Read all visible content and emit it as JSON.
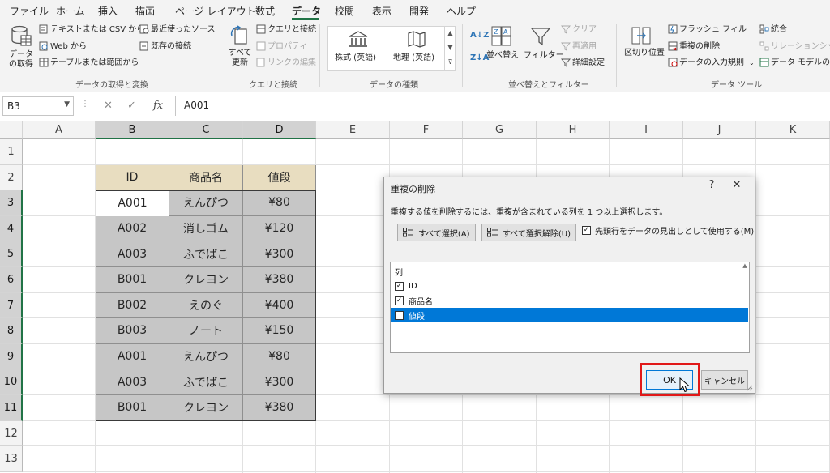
{
  "menu": {
    "tabs": [
      "ファイル",
      "ホーム",
      "挿入",
      "描画",
      "ページ レイアウト",
      "数式",
      "データ",
      "校閲",
      "表示",
      "開発",
      "ヘルプ"
    ],
    "active_tab": "データ",
    "accent_color": "#217346"
  },
  "ribbon": {
    "get_transform": {
      "label": "データの取得と変換",
      "get_data": "データの取得",
      "from_text_csv": "テキストまたは CSV から",
      "from_web": "Web から",
      "from_table": "テーブルまたは範囲から",
      "recent_sources": "最近使ったソース",
      "existing_connections": "既存の接続"
    },
    "queries": {
      "label": "クエリと接続",
      "refresh_all": "すべて更新",
      "queries_connections": "クエリと接続",
      "properties": "プロパティ",
      "edit_links": "リンクの編集"
    },
    "data_types": {
      "label": "データの種類",
      "stocks": "株式 (英語)",
      "geography": "地理 (英語)"
    },
    "sort_filter": {
      "label": "並べ替えとフィルター",
      "sort": "並べ替え",
      "filter": "フィルター",
      "clear": "クリア",
      "reapply": "再適用",
      "advanced": "詳細設定"
    },
    "data_tools": {
      "label": "データ ツール",
      "text_to_columns": "区切り位置",
      "flash_fill": "フラッシュ フィル",
      "remove_duplicates": "重複の削除",
      "data_validation": "データの入力規則",
      "consolidate": "統合",
      "relationships": "リレーションシップ",
      "data_model": "データ モデルの管"
    }
  },
  "formula_bar": {
    "name_box": "B3",
    "formula": "A001"
  },
  "sheet": {
    "columns": [
      "A",
      "B",
      "C",
      "D",
      "E",
      "F",
      "G",
      "H",
      "I",
      "J",
      "K"
    ],
    "rows": [
      "1",
      "2",
      "3",
      "4",
      "5",
      "6",
      "7",
      "8",
      "9",
      "10",
      "11",
      "12",
      "13"
    ],
    "table_headers": [
      "ID",
      "商品名",
      "値段"
    ],
    "table_rows": [
      [
        "A001",
        "えんぴつ",
        "¥80"
      ],
      [
        "A002",
        "消しゴム",
        "¥120"
      ],
      [
        "A003",
        "ふでばこ",
        "¥300"
      ],
      [
        "B001",
        "クレヨン",
        "¥380"
      ],
      [
        "B002",
        "えのぐ",
        "¥400"
      ],
      [
        "B003",
        "ノート",
        "¥150"
      ],
      [
        "A001",
        "えんぴつ",
        "¥80"
      ],
      [
        "A003",
        "ふでばこ",
        "¥300"
      ],
      [
        "B001",
        "クレヨン",
        "¥380"
      ]
    ],
    "header_fill": "#e8ddc0",
    "selection_fill": "#c6c6c6"
  },
  "dialog": {
    "title": "重複の削除",
    "help": "?",
    "close": "✕",
    "message": "重複する値を削除するには、重複が含まれている列を 1 つ以上選択します。",
    "select_all": "すべて選択(A)",
    "unselect_all": "すべて選択解除(U)",
    "has_headers": "先頭行をデータの見出しとして使用する(M)",
    "has_headers_checked": true,
    "columns_header": "列",
    "columns": [
      {
        "label": "ID",
        "checked": true,
        "selected": false
      },
      {
        "label": "商品名",
        "checked": true,
        "selected": false
      },
      {
        "label": "値段",
        "checked": false,
        "selected": true
      }
    ],
    "ok": "OK",
    "cancel": "キャンセル",
    "highlight_color": "#e11818"
  }
}
